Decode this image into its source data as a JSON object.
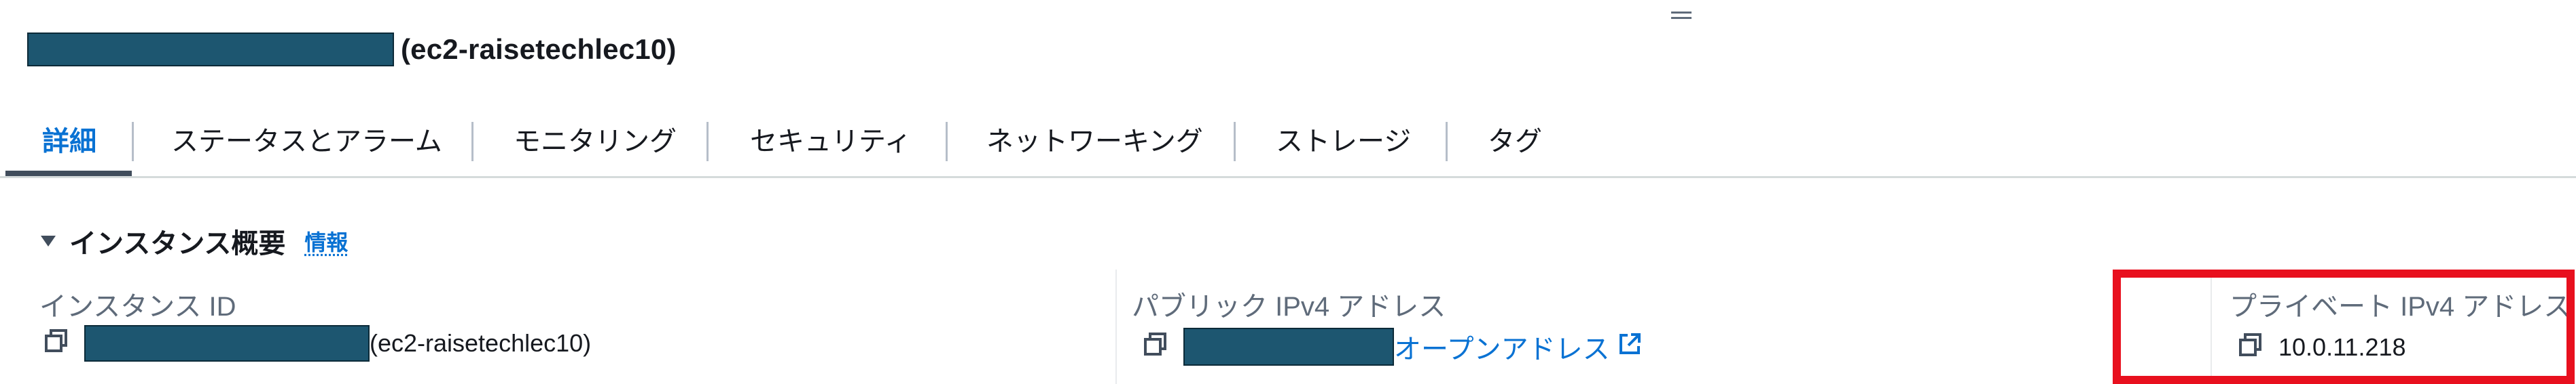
{
  "header": {
    "instance_name_suffix": "(ec2-raisetechlec10)"
  },
  "tabs": [
    {
      "label": "詳細",
      "active": true
    },
    {
      "label": "ステータスとアラーム",
      "active": false
    },
    {
      "label": "モニタリング",
      "active": false
    },
    {
      "label": "セキュリティ",
      "active": false
    },
    {
      "label": "ネットワーキング",
      "active": false
    },
    {
      "label": "ストレージ",
      "active": false
    },
    {
      "label": "タグ",
      "active": false
    }
  ],
  "section": {
    "title": "インスタンス概要",
    "info_link": "情報"
  },
  "fields": {
    "instance_id": {
      "label": "インスタンス ID",
      "value_suffix": "(ec2-raisetechlec10)"
    },
    "public_ipv4": {
      "label": "パブリック IPv4 アドレス",
      "open_address_link": "オープンアドレス"
    },
    "private_ipv4": {
      "label": "プライベート IPv4 アドレス",
      "value": "10.0.11.218"
    }
  },
  "colors": {
    "accent_link": "#0972d3",
    "highlight": "#e8101e",
    "redaction": "#1d5670"
  },
  "icons": [
    "drag-handle-icon",
    "caret-down-icon",
    "copy-icon",
    "external-link-icon"
  ]
}
